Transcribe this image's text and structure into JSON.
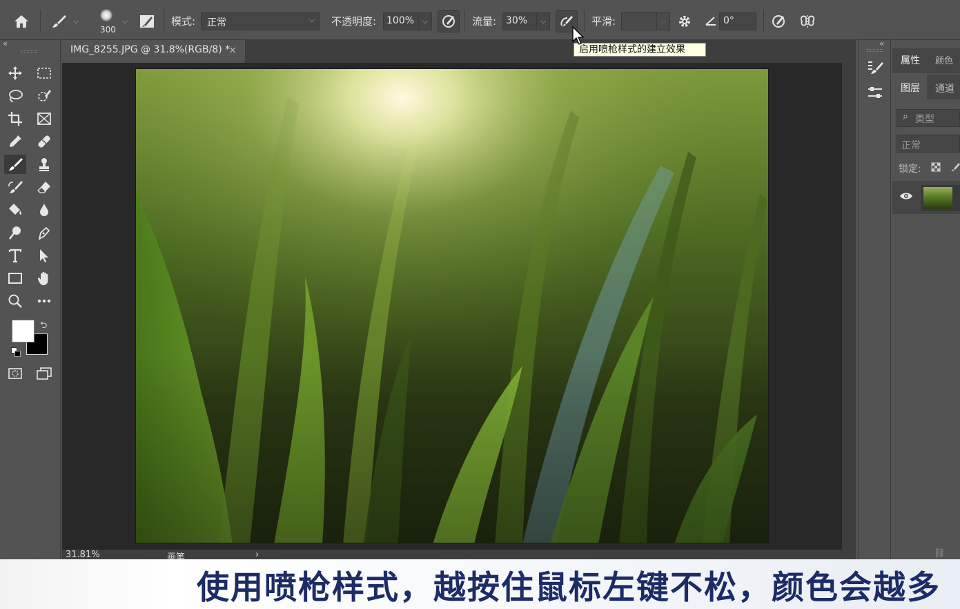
{
  "options_bar": {
    "brush_size": "300",
    "mode_label": "模式:",
    "mode_value": "正常",
    "opacity_label": "不透明度:",
    "opacity_value": "100%",
    "flow_label": "流量:",
    "flow_value": "30%",
    "smoothing_label": "平滑:",
    "smoothing_value": "",
    "angle_value": "0°",
    "tooltip": "启用喷枪样式的建立效果"
  },
  "document": {
    "tab_title": "IMG_8255.JPG @ 31.8%(RGB/8) *",
    "close_glyph": "×",
    "zoom": "31.81%",
    "status_tool": "画笔",
    "status_arrow": "›"
  },
  "right_panel": {
    "tab_properties": "属性",
    "tab_color": "颜色",
    "tab_layers": "图层",
    "tab_channels": "通道",
    "search_placeholder": "类型",
    "blend_mode": "正常",
    "lock_label": "锁定:"
  },
  "subtitle": "使用喷枪样式，越按住鼠标左键不松，颜色会越多",
  "colors": {
    "ui_bg": "#535353",
    "canvas_bg": "#282828",
    "subtitle_text": "#1d2c66",
    "tooltip_bg": "#ffffe1"
  },
  "icons": [
    "home-icon",
    "brush-icon",
    "brush-settings-icon",
    "pressure-opacity-icon",
    "airbrush-icon",
    "gear-icon",
    "angle-icon",
    "pressure-size-icon",
    "symmetry-icon"
  ]
}
